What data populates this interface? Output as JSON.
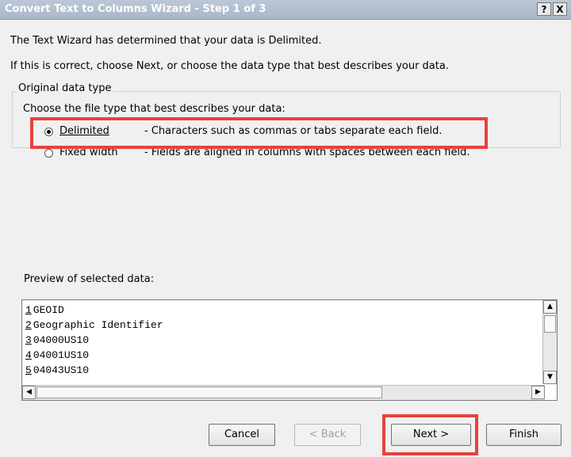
{
  "window": {
    "title": "Convert Text to Columns Wizard - Step 1 of 3",
    "help_label": "?",
    "close_label": "X"
  },
  "info": {
    "line1": "The Text Wizard has determined that your data is Delimited.",
    "line2": "If this is correct, choose Next, or choose the data type that best describes your data."
  },
  "data_type": {
    "group_label": "Original data type",
    "prompt": "Choose the file type that best describes your data:",
    "options": [
      {
        "label": "Delimited",
        "description": "- Characters such as commas or tabs separate each field.",
        "selected": true
      },
      {
        "label": "Fixed width",
        "description": "- Fields are aligned in columns with spaces between each field.",
        "selected": false
      }
    ]
  },
  "preview": {
    "label": "Preview of selected data:",
    "rows": [
      {
        "num": "1",
        "text": "GEOID"
      },
      {
        "num": "2",
        "text": "Geographic Identifier"
      },
      {
        "num": "3",
        "text": "04000US10"
      },
      {
        "num": "4",
        "text": "04001US10"
      },
      {
        "num": "5",
        "text": "04043US10"
      }
    ]
  },
  "buttons": {
    "cancel": "Cancel",
    "back": "< Back",
    "next": "Next >",
    "finish": "Finish"
  },
  "colors": {
    "highlight": "#e8413f",
    "titlebar": "#bcc7d6"
  }
}
